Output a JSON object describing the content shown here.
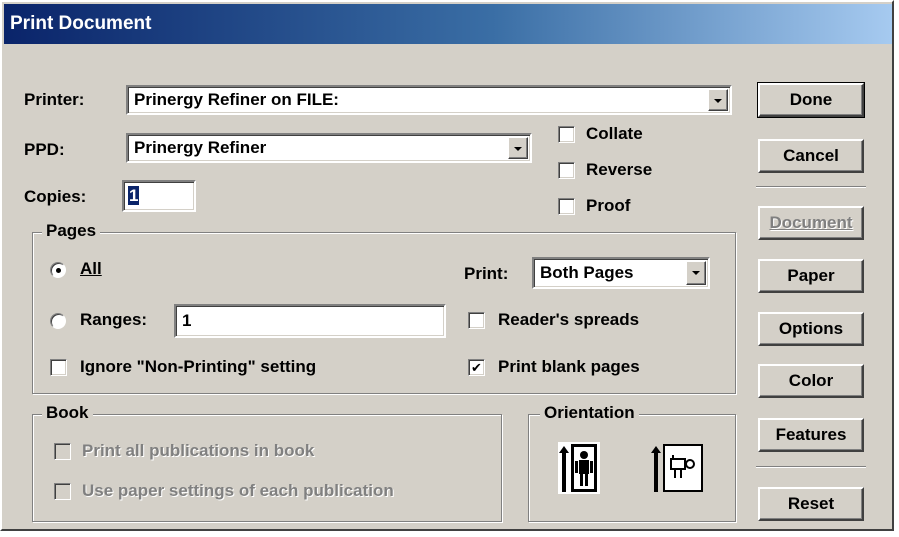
{
  "window": {
    "title": "Print Document"
  },
  "printer": {
    "label": "Printer:",
    "value": "Prinergy Refiner on FILE:"
  },
  "ppd": {
    "label": "PPD:",
    "value": "Prinergy Refiner"
  },
  "copies": {
    "label": "Copies:",
    "value": "1"
  },
  "options": {
    "collate": {
      "label": "Collate",
      "checked": false
    },
    "reverse": {
      "label": "Reverse",
      "checked": false
    },
    "proof": {
      "label": "Proof",
      "checked": false
    }
  },
  "pages": {
    "title": "Pages",
    "all_label": "All",
    "ranges_label": "Ranges:",
    "ranges_value": "1",
    "ignore_label": "Ignore \"Non-Printing\" setting",
    "print_label": "Print:",
    "print_value": "Both Pages",
    "readers_spreads_label": "Reader's spreads",
    "print_blank_label": "Print blank pages",
    "selected": "All",
    "ignore_checked": false,
    "readers_spreads_checked": false,
    "print_blank_checked": true
  },
  "book": {
    "title": "Book",
    "print_all_label": "Print all publications in book",
    "use_paper_label": "Use paper settings of each publication"
  },
  "orientation": {
    "title": "Orientation",
    "icons": [
      "portrait-icon",
      "landscape-icon"
    ]
  },
  "buttons": {
    "done": "Done",
    "cancel": "Cancel",
    "document": "Document",
    "paper": "Paper",
    "options": "Options",
    "color": "Color",
    "features": "Features",
    "reset": "Reset"
  },
  "colors": {
    "titlebar": "#0a246a",
    "face": "#d4d0c8",
    "disabled_text": "#808080"
  }
}
